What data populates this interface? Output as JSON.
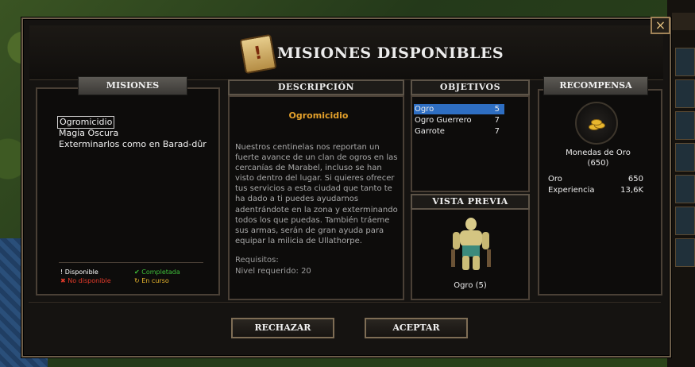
{
  "window": {
    "title": "MISIONES DISPONIBLES",
    "close_label": "×"
  },
  "missions_panel": {
    "header": "MISIONES",
    "items": [
      {
        "label": "Ogromicidio",
        "selected": true
      },
      {
        "label": "Magia Oscura",
        "selected": false
      },
      {
        "label": "Exterminarlos como en Barad-dûr",
        "selected": false
      }
    ],
    "legend": [
      {
        "symbol": "!",
        "label": "Disponible",
        "color": "#ffffff"
      },
      {
        "symbol": "✔",
        "label": "Completada",
        "color": "#3fbf3a"
      },
      {
        "symbol": "✖",
        "label": "No disponible",
        "color": "#e03a2a"
      },
      {
        "symbol": "↻",
        "label": "En curso",
        "color": "#e8b62e"
      }
    ]
  },
  "description_panel": {
    "header": "DESCRIPCIÓN",
    "quest_title": "Ogromicidio",
    "text": "Nuestros centinelas nos reportan un fuerte avance de un clan de ogros en las cercanías de Marabel, incluso se han visto dentro del lugar. Si quieres ofrecer tus servicios a esta ciudad que tanto te ha dado a ti puedes ayudarnos adentrándote en la zona y exterminando todos los que puedas. También tráeme sus armas, serán de gran ayuda para equipar la milicia de Ullathorpe.",
    "requirements_label": "Requisitos:",
    "level_requirement": "Nivel requerido: 20"
  },
  "objectives_panel": {
    "header": "OBJETIVOS",
    "items": [
      {
        "name": "Ogro",
        "count": "5",
        "selected": true
      },
      {
        "name": "Ogro Guerrero",
        "count": "7",
        "selected": false
      },
      {
        "name": "Garrote",
        "count": "7",
        "selected": false
      }
    ]
  },
  "preview_panel": {
    "header": "VISTA PREVIA",
    "caption": "Ogro (5)"
  },
  "reward_panel": {
    "header": "RECOMPENSA",
    "item_name": "Monedas de Oro",
    "item_amount": "(650)",
    "rows": [
      {
        "label": "Oro",
        "value": "650"
      },
      {
        "label": "Experiencia",
        "value": "13,6K"
      }
    ]
  },
  "buttons": {
    "reject": "RECHAZAR",
    "accept": "ACEPTAR"
  },
  "colors": {
    "accent_orange": "#e4a12b",
    "selection_blue": "#2e6ec2",
    "frame_bronze": "#7e6d55"
  }
}
